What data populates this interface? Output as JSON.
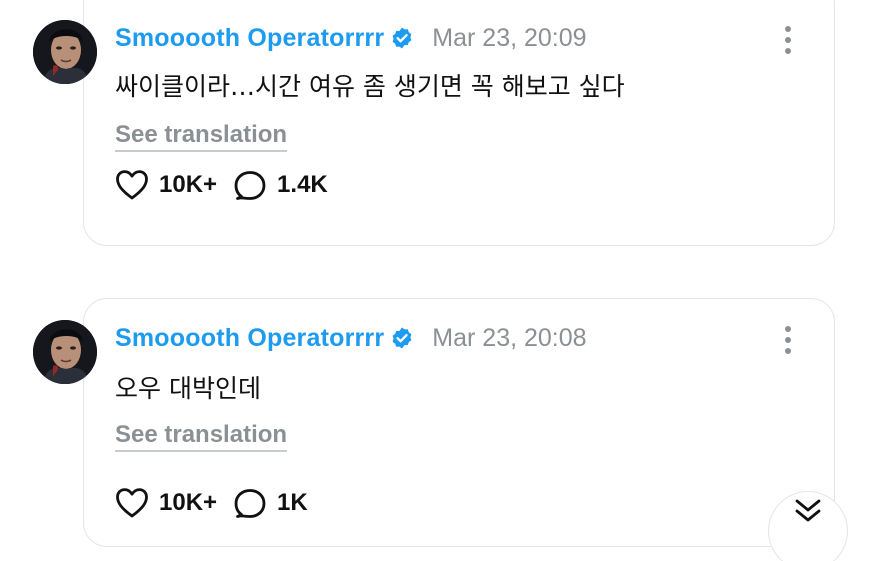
{
  "posts": [
    {
      "author": "Smooooth Operatorrrr",
      "timestamp": "Mar 23, 20:09",
      "text": "싸이클이라…시간 여유 좀 생기면 꼭 해보고 싶다",
      "translate_label": "See translation",
      "likes": "10K+",
      "replies": "1.4K"
    },
    {
      "author": "Smooooth Operatorrrr",
      "timestamp": "Mar 23, 20:08",
      "text": "오우 대박인데",
      "translate_label": "See translation",
      "likes": "10K+",
      "replies": "1K"
    }
  ],
  "colors": {
    "author": "#1d9bf0",
    "verified_badge": "#1d9bf0",
    "muted_text": "#8b9095",
    "body_text": "#111111",
    "card_border": "#e3e5ea"
  },
  "icons": [
    "verified-badge-icon",
    "more-vertical-icon",
    "heart-icon",
    "reply-bubble-icon",
    "double-chevron-down-icon"
  ]
}
